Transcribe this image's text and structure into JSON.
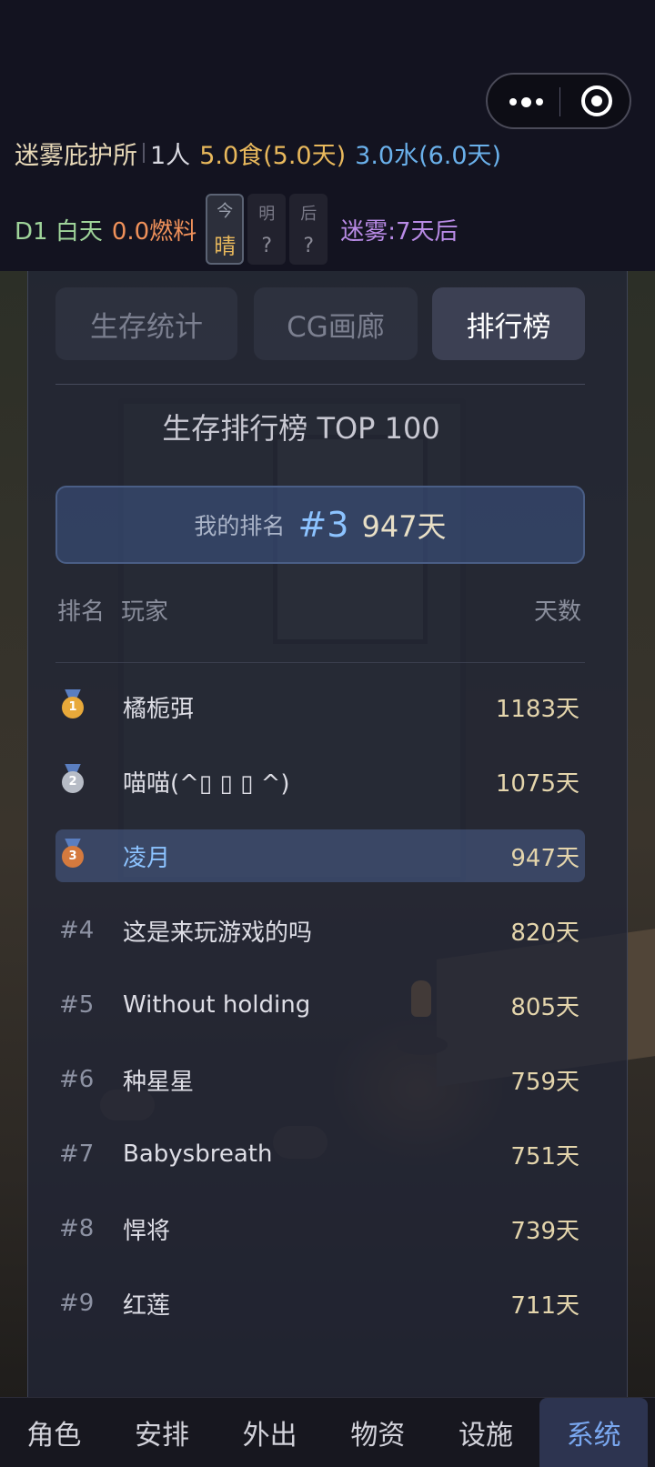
{
  "status": {
    "shelter_name": "迷雾庇护所",
    "people": "1人",
    "food": "5.0食(5.0天)",
    "water": "3.0水(6.0天)",
    "day": "D1 白天",
    "fuel": "0.0燃料",
    "weather": [
      {
        "label": "今",
        "value": "晴",
        "active": true
      },
      {
        "label": "明",
        "value": "?",
        "active": false
      },
      {
        "label": "后",
        "value": "?",
        "active": false
      }
    ],
    "fog": "迷雾:7天后"
  },
  "tabs": [
    {
      "label": "生存统计",
      "active": false
    },
    {
      "label": "CG画廊",
      "active": false
    },
    {
      "label": "排行榜",
      "active": true
    }
  ],
  "leaderboard": {
    "title": "生存排行榜 TOP 100",
    "my_rank_label": "我的排名",
    "my_rank": "#3",
    "my_days": "947天",
    "columns": {
      "rank": "排名",
      "player": "玩家",
      "days": "天数"
    },
    "rows": [
      {
        "medal": "gold",
        "medal_num": "1",
        "rank": "",
        "name": "橘栀弭",
        "days": "1183天",
        "highlight": false
      },
      {
        "medal": "silver",
        "medal_num": "2",
        "rank": "",
        "name": "喵喵(^▯ ▯ ▯ ^)",
        "days": "1075天",
        "highlight": false
      },
      {
        "medal": "bronze",
        "medal_num": "3",
        "rank": "",
        "name": "凌月",
        "days": "947天",
        "highlight": true
      },
      {
        "medal": "",
        "medal_num": "",
        "rank": "#4",
        "name": "这是来玩游戏的吗",
        "days": "820天",
        "highlight": false
      },
      {
        "medal": "",
        "medal_num": "",
        "rank": "#5",
        "name": "Without holding",
        "days": "805天",
        "highlight": false
      },
      {
        "medal": "",
        "medal_num": "",
        "rank": "#6",
        "name": "种星星",
        "days": "759天",
        "highlight": false
      },
      {
        "medal": "",
        "medal_num": "",
        "rank": "#7",
        "name": "Babysbreath",
        "days": "751天",
        "highlight": false
      },
      {
        "medal": "",
        "medal_num": "",
        "rank": "#8",
        "name": "悍将",
        "days": "739天",
        "highlight": false
      },
      {
        "medal": "",
        "medal_num": "",
        "rank": "#9",
        "name": "红莲",
        "days": "711天",
        "highlight": false
      }
    ]
  },
  "bottom_nav": [
    {
      "label": "角色",
      "active": false
    },
    {
      "label": "安排",
      "active": false
    },
    {
      "label": "外出",
      "active": false
    },
    {
      "label": "物资",
      "active": false
    },
    {
      "label": "设施",
      "active": false
    },
    {
      "label": "系统",
      "active": true
    }
  ]
}
